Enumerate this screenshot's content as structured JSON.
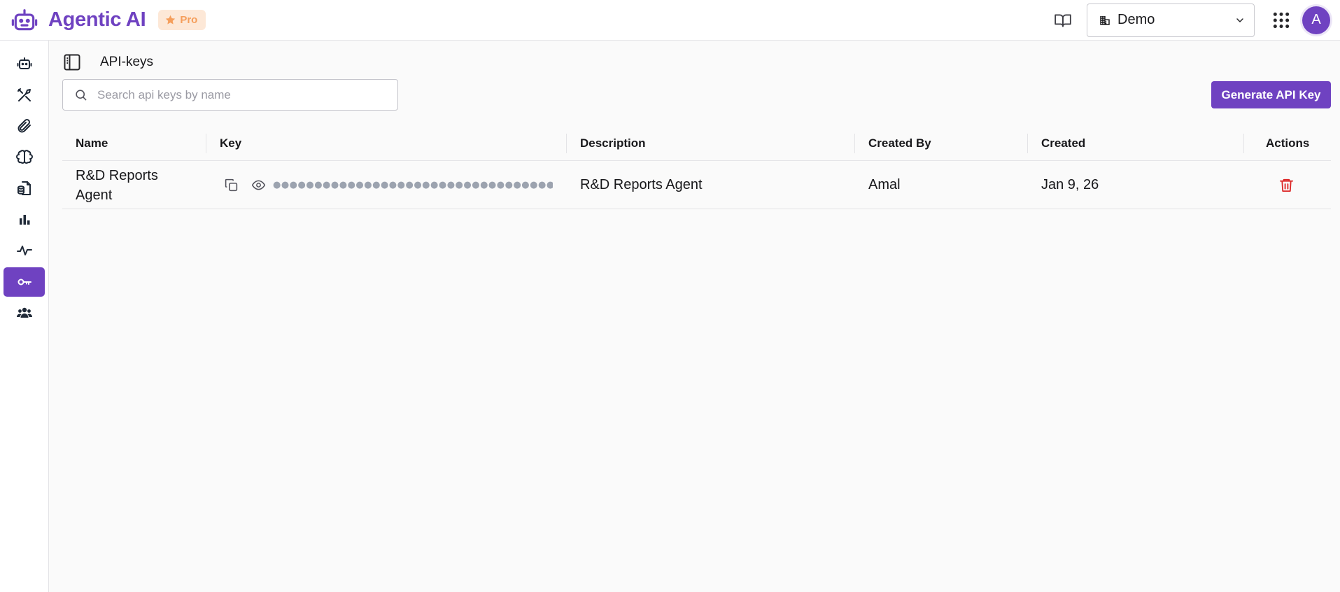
{
  "brand": {
    "title": "Agentic AI",
    "badge": "Pro",
    "accent": "#6f42c1",
    "badge_color": "#f59e5b"
  },
  "header": {
    "org": {
      "name": "Demo"
    },
    "avatar_initial": "A",
    "icons": [
      "book-open-icon",
      "building-icon",
      "chevron-down-icon",
      "grid-dots-icon"
    ]
  },
  "sidebar": {
    "items": [
      {
        "name": "agents",
        "icon": "robot-icon",
        "active": false
      },
      {
        "name": "tools",
        "icon": "tools-icon",
        "active": false
      },
      {
        "name": "attachments",
        "icon": "paperclip-icon",
        "active": false
      },
      {
        "name": "models",
        "icon": "brain-icon",
        "active": false
      },
      {
        "name": "data-sources",
        "icon": "database-document-icon",
        "active": false
      },
      {
        "name": "analytics",
        "icon": "bar-chart-icon",
        "active": false
      },
      {
        "name": "monitoring",
        "icon": "activity-icon",
        "active": false
      },
      {
        "name": "api-keys",
        "icon": "key-icon",
        "active": true
      },
      {
        "name": "users",
        "icon": "users-icon",
        "active": false
      }
    ]
  },
  "page": {
    "title": "API-keys",
    "search_placeholder": "Search api keys by name",
    "search_value": "",
    "generate_label": "Generate API Key"
  },
  "table": {
    "columns": [
      "Name",
      "Key",
      "Description",
      "Created By",
      "Created",
      "Actions"
    ],
    "rows": [
      {
        "name": "R&D Reports Agent",
        "key_masked": "●●●●●●●●●●●●●●●●●●●●●●●●●●●●●●●●●●●●●●●●●",
        "description": "R&D Reports Agent",
        "created_by": "Amal",
        "created": "Jan 9, 26"
      }
    ]
  },
  "colors": {
    "danger": "#dc2626",
    "border": "#e4e4e7"
  }
}
